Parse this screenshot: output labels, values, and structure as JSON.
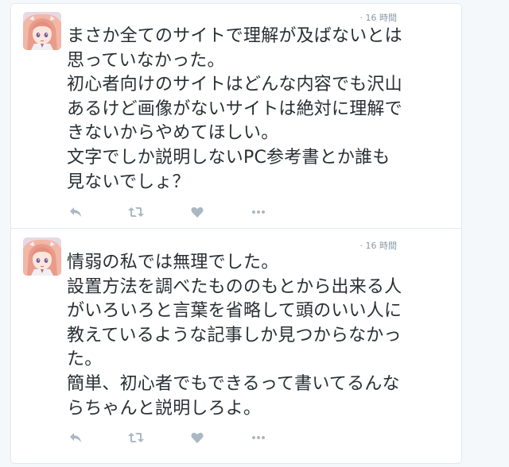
{
  "colors": {
    "text": "#292f33",
    "meta": "#8899a6",
    "action_icon": "#aab8c2",
    "border": "#e1e8ed",
    "background": "#f5f8fa"
  },
  "tweets": [
    {
      "timestamp": "· 16 時間",
      "avatar": "avatar-image",
      "lines": [
        "まさか全てのサイトで理解が及ばないとは",
        "思っていなかった。",
        "初心者向けのサイトはどんな内容でも沢山",
        "あるけど画像がないサイトは絶対に理解で",
        "きないからやめてほしい。",
        "文字でしか説明しないPC参考書とか誰も",
        "見ないでしょ？"
      ],
      "actions": [
        "reply-icon",
        "retweet-icon",
        "like-icon",
        "more-icon"
      ]
    },
    {
      "timestamp": "· 16 時間",
      "avatar": "avatar-image",
      "lines": [
        "情弱の私では無理でした。",
        "設置方法を調べたもののもとから出来る人",
        "がいろいろと言葉を省略して頭のいい人に",
        "教えているような記事しか見つからなかっ",
        "た。",
        "簡単、初心者でもできるって書いてるんな",
        "らちゃんと説明しろよ。"
      ],
      "actions": [
        "reply-icon",
        "retweet-icon",
        "like-icon",
        "more-icon"
      ]
    }
  ]
}
